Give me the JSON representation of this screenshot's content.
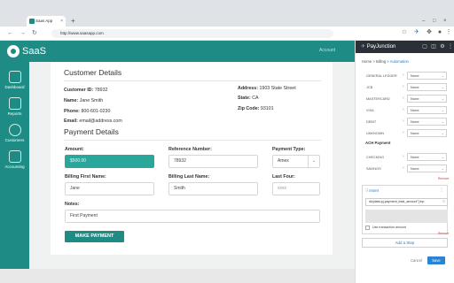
{
  "browser": {
    "tab_title": "Saas App",
    "url": "http://www.saasapp.com"
  },
  "app": {
    "brand": "SaaS",
    "account": "Account"
  },
  "sidebar": {
    "items": [
      {
        "label": "Dashboard",
        "icon": "dashboard-icon"
      },
      {
        "label": "Reports",
        "icon": "reports-icon"
      },
      {
        "label": "Customers",
        "icon": "customers-icon"
      },
      {
        "label": "Accounting",
        "icon": "accounting-icon"
      }
    ]
  },
  "customer": {
    "heading": "Customer Details",
    "id_label": "Customer ID:",
    "id_value": "78932",
    "name_label": "Name:",
    "name_value": "Jane Smith",
    "phone_label": "Phone:",
    "phone_value": "800-601-0230",
    "email_label": "Email:",
    "email_value": "email@address.com",
    "address_label": "Address:",
    "address_value": "1903 State Street",
    "state_label": "State:",
    "state_value": "CA",
    "zip_label": "Zip Code:",
    "zip_value": "93101"
  },
  "payment": {
    "heading": "Payment Details",
    "amount_label": "Amount:",
    "amount_value": "$500.00",
    "reference_label": "Reference Number:",
    "reference_value": "78932",
    "type_label": "Payment Type:",
    "type_value": "Amex",
    "first_label": "Billing First Name:",
    "first_value": "Jane",
    "last_label": "Billing Last Name:",
    "last_value": "Smith",
    "four_label": "Last Four:",
    "four_placeholder": "xxxx",
    "notes_label": "Notes:",
    "notes_value": "First Payment",
    "submit": "MAKE PAYMENT"
  },
  "panel": {
    "brand": "PayJunction",
    "breadcrumb": {
      "home": "Home",
      "billing": "Billing",
      "current": "Automation"
    },
    "rows": [
      {
        "label": "GENERAL LEDGER",
        "value": "None"
      },
      {
        "label": "JCB",
        "value": "None"
      },
      {
        "label": "MASTERCARD",
        "value": "None"
      },
      {
        "label": "VISA",
        "value": "None"
      },
      {
        "label": "DEBIT",
        "value": "None"
      },
      {
        "label": "UNKNOWN",
        "value": "None"
      }
    ],
    "ach_heading": "ACH Payment",
    "ach_rows": [
      {
        "label": "CHECKING",
        "value": "None"
      },
      {
        "label": "SAVINGS",
        "value": "None"
      }
    ],
    "remove": "Remove",
    "step_tag": "Insert",
    "step_code": "div[data-pj-payment_total_amount\"] inp",
    "checkbox_label": "Use transaction amount",
    "add_step": "Add a Step",
    "cancel": "Cancel",
    "save": "Save"
  }
}
